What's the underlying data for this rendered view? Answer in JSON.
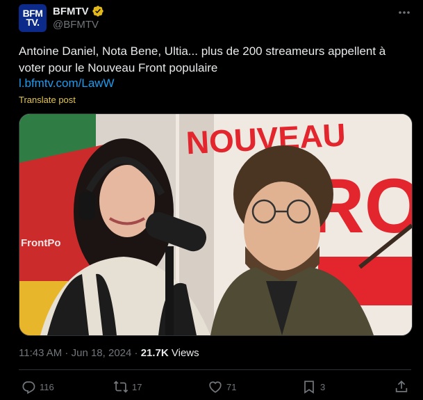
{
  "author": {
    "avatar_text_line1": "BFM",
    "avatar_text_line2": "TV.",
    "display_name": "BFMTV",
    "handle": "@BFMTV"
  },
  "post": {
    "text": "Antoine Daniel, Nota Bene, Ultia... plus de 200 streameurs appellent à voter pour le Nouveau Front populaire",
    "link": "l.bfmtv.com/LawW",
    "translate_label": "Translate post",
    "image_sign_text_line1": "NOUVEAU",
    "image_sign_text_line2": "FRON",
    "image_banner_text": "FrontPo",
    "time": "11:43 AM",
    "separator": " · ",
    "date": "Jun 18, 2024",
    "views_count": "21.7K",
    "views_label": " Views"
  },
  "actions": {
    "replies": "116",
    "reposts": "17",
    "likes": "71",
    "bookmarks": "3"
  },
  "icons": {
    "verified": "verified-badge-icon",
    "more": "more-dots-icon",
    "reply": "reply-icon",
    "repost": "repost-icon",
    "like": "heart-icon",
    "bookmark": "bookmark-icon",
    "share": "share-icon"
  },
  "colors": {
    "background": "#000000",
    "text": "#e7e9ea",
    "muted": "#71767b",
    "link": "#1d9bf0",
    "translate": "#e5c74a",
    "verified_gold": "#e2b719",
    "avatar_blue": "#0b2a8a",
    "sign_red": "#e3262e"
  }
}
